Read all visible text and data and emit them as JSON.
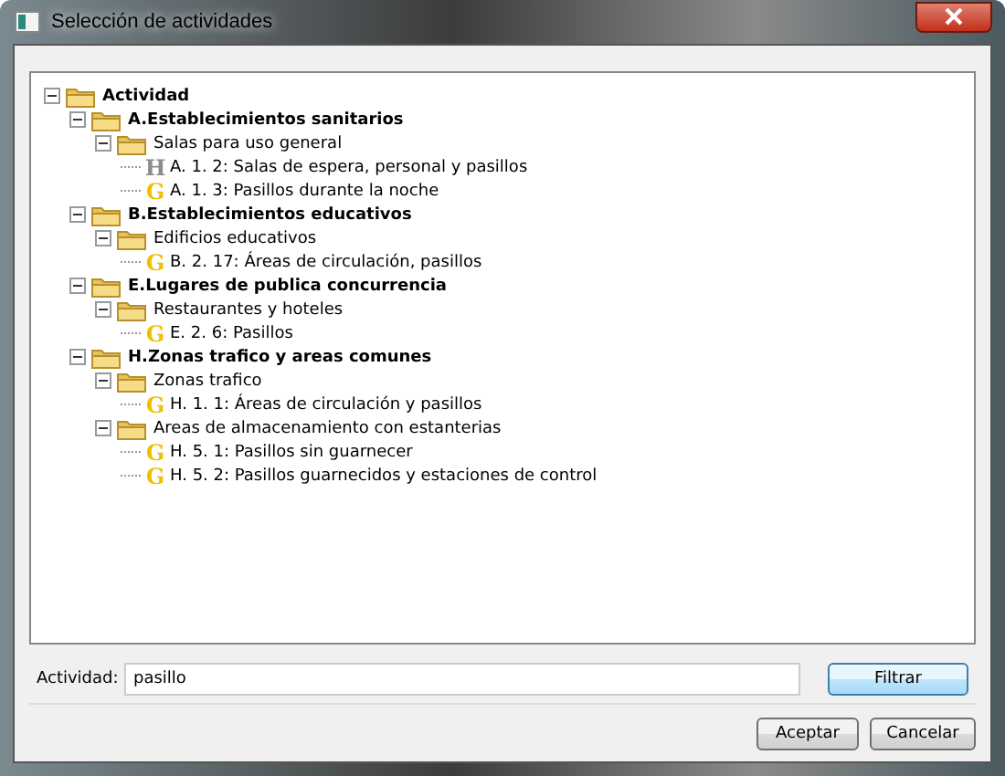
{
  "window": {
    "title": "Selección de actividades"
  },
  "tree": [
    {
      "kind": "folder",
      "label": "Actividad",
      "expanded": true,
      "children": [
        {
          "kind": "folder",
          "label": "A.Establecimientos sanitarios",
          "expanded": true,
          "children": [
            {
              "kind": "folder",
              "label": "Salas para uso general",
              "expanded": true,
              "children": [
                {
                  "kind": "leaf",
                  "badge": "H",
                  "color": "#8c8c8c",
                  "label": "A. 1. 2: Salas de espera, personal y pasillos"
                },
                {
                  "kind": "leaf",
                  "badge": "G",
                  "color": "#f0c000",
                  "label": "A. 1. 3: Pasillos durante la noche"
                }
              ]
            }
          ]
        },
        {
          "kind": "folder",
          "label": "B.Establecimientos educativos",
          "expanded": true,
          "children": [
            {
              "kind": "folder",
              "label": "Edificios educativos",
              "expanded": true,
              "children": [
                {
                  "kind": "leaf",
                  "badge": "G",
                  "color": "#f0c000",
                  "label": "B. 2. 17: Áreas de circulación, pasillos"
                }
              ]
            }
          ]
        },
        {
          "kind": "folder",
          "label": "E.Lugares de publica concurrencia",
          "expanded": true,
          "children": [
            {
              "kind": "folder",
              "label": "Restaurantes y hoteles",
              "expanded": true,
              "children": [
                {
                  "kind": "leaf",
                  "badge": "G",
                  "color": "#f0c000",
                  "label": "E. 2. 6: Pasillos"
                }
              ]
            }
          ]
        },
        {
          "kind": "folder",
          "label": "H.Zonas trafico y areas comunes",
          "expanded": true,
          "children": [
            {
              "kind": "folder",
              "label": "Zonas trafico",
              "expanded": true,
              "children": [
                {
                  "kind": "leaf",
                  "badge": "G",
                  "color": "#f0c000",
                  "label": "H. 1. 1: Áreas de circulación y pasillos"
                }
              ]
            },
            {
              "kind": "folder",
              "label": "Areas de almacenamiento con estanterias",
              "expanded": true,
              "children": [
                {
                  "kind": "leaf",
                  "badge": "G",
                  "color": "#f0c000",
                  "label": "H. 5. 1: Pasillos sin guarnecer"
                },
                {
                  "kind": "leaf",
                  "badge": "G",
                  "color": "#f0c000",
                  "label": "H. 5. 2: Pasillos guarnecidos y estaciones de control"
                }
              ]
            }
          ]
        }
      ]
    }
  ],
  "filter": {
    "label": "Actividad:",
    "value": "pasillo",
    "button": "Filtrar"
  },
  "buttons": [
    "Aceptar",
    "Cancelar"
  ]
}
